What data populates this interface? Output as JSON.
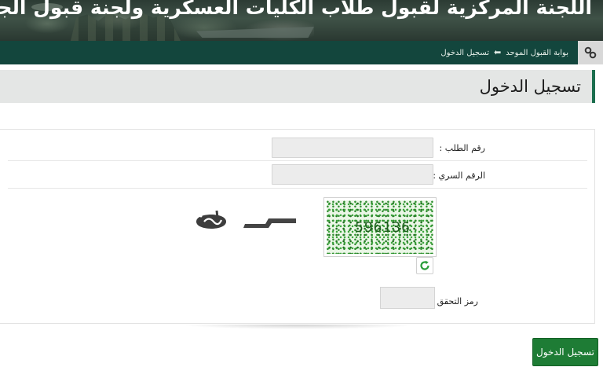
{
  "header": {
    "title": "اللجنة المركزية لقبول طلاب الكليات العسكرية ولجنة قبول الجامعيين"
  },
  "breadcrumb": {
    "home_label": "بوابة القبول الموحد",
    "separator": "⬅",
    "current_label": "تسجيل الدخول",
    "icon": "link-icon"
  },
  "page": {
    "title": "تسجيل الدخول"
  },
  "form": {
    "request_number_label": "رقم الطلب :",
    "request_number_value": "",
    "password_label": "الرقم السري :",
    "password_value": "",
    "captcha_text": "596136",
    "refresh_icon": "refresh-icon",
    "verification_code_label": "رمز التحقق :",
    "verification_code_value": ""
  },
  "actions": {
    "login_button_label": "تسجيل الدخول"
  },
  "colors": {
    "crumbbar_bg": "#13463d",
    "accent_green": "#1e7c35",
    "title_border": "#1b6e4e"
  }
}
